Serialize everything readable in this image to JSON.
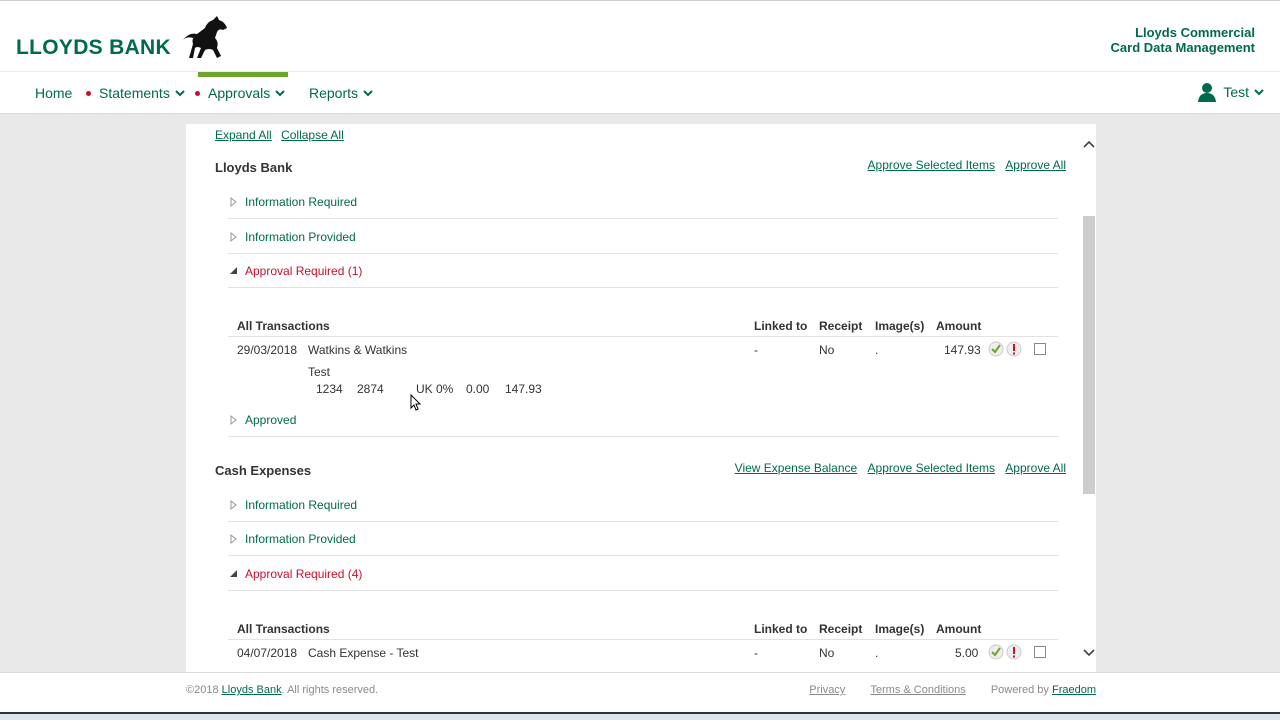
{
  "brand": {
    "logo_text": "LLOYDS BANK",
    "app_title_line1": "Lloyds Commercial",
    "app_title_line2": "Card Data Management",
    "primary_color": "#006a4d",
    "alert_color": "#c8102e",
    "active_tab_color": "#6ea52f"
  },
  "nav": {
    "home": "Home",
    "statements": "Statements",
    "approvals": "Approvals",
    "reports": "Reports",
    "active": "Approvals"
  },
  "user": {
    "name": "Test",
    "icon": "user-icon"
  },
  "toolbar": {
    "expand_all": "Expand All",
    "collapse_all": "Collapse All"
  },
  "sections": [
    {
      "title": "Lloyds Bank",
      "actions": [
        "Approve Selected Items",
        "Approve All"
      ],
      "groups": [
        "Information Required",
        "Information Provided",
        "Approval Required (1)",
        "Approved"
      ],
      "table": {
        "headers": [
          "All Transactions",
          "Linked to",
          "Receipt",
          "Image(s)",
          "Amount"
        ],
        "rows": [
          {
            "date": "29/03/2018",
            "merchant": "Watkins & Watkins",
            "linked": "-",
            "receipt": "No",
            "images": ".",
            "amount": "147.93",
            "note": "Test",
            "detail": [
              "1234",
              "2874",
              "UK 0%",
              "0.00",
              "147.93"
            ]
          }
        ]
      }
    },
    {
      "title": "Cash Expenses",
      "actions": [
        "View Expense Balance",
        "Approve Selected Items",
        "Approve All"
      ],
      "groups": [
        "Information Required",
        "Information Provided",
        "Approval Required (4)"
      ],
      "table": {
        "headers": [
          "All Transactions",
          "Linked to",
          "Receipt",
          "Image(s)",
          "Amount"
        ],
        "rows": [
          {
            "date": "04/07/2018",
            "merchant": "Cash Expense - Test",
            "linked": "-",
            "receipt": "No",
            "images": ".",
            "amount": "5.00"
          }
        ]
      }
    }
  ],
  "footer": {
    "copyright_prefix": "©2018",
    "copyright_link": "Lloyds Bank",
    "copyright_suffix": ". All rights reserved.",
    "privacy": "Privacy",
    "terms": "Terms & Conditions",
    "powered_by": "Powered by",
    "powered_link": "Fraedom"
  }
}
